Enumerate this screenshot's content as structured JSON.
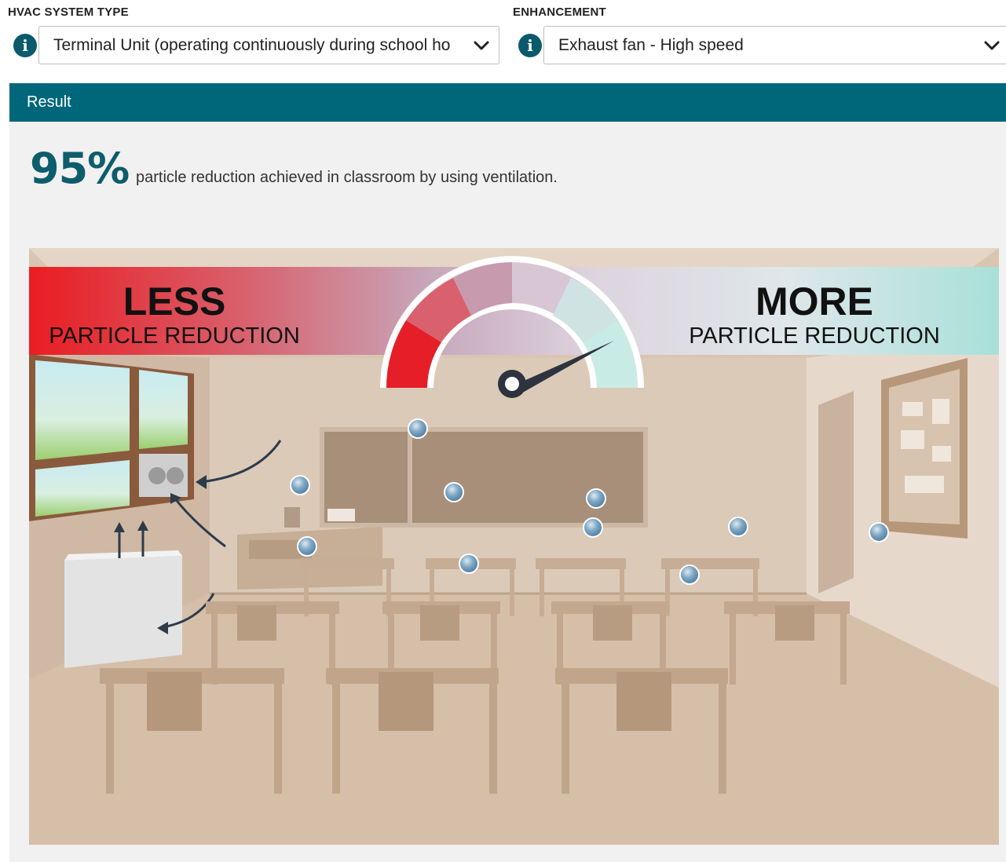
{
  "hvac": {
    "label": "HVAC SYSTEM TYPE",
    "value": "Terminal Unit (operating continuously during school ho"
  },
  "enhancement": {
    "label": "ENHANCEMENT",
    "value": "Exhaust fan - High speed"
  },
  "result": {
    "header": "Result",
    "percentage": "95%",
    "description": "particle reduction achieved in classroom by using ventilation."
  },
  "gauge": {
    "less_title": "LESS",
    "less_subtitle": "PARTICLE REDUCTION",
    "more_title": "MORE",
    "more_subtitle": "PARTICLE REDUCTION",
    "reduction_percent": 95
  },
  "colors": {
    "accent": "#00677b",
    "percent_text": "#0e5d6c",
    "info_icon": "#0b5a6b",
    "less_red": "#e8151e",
    "more_teal": "#a8e0da"
  },
  "icons": {
    "info": "info-icon",
    "dropdown": "chevron-down-icon",
    "particle": "particle-icon"
  }
}
